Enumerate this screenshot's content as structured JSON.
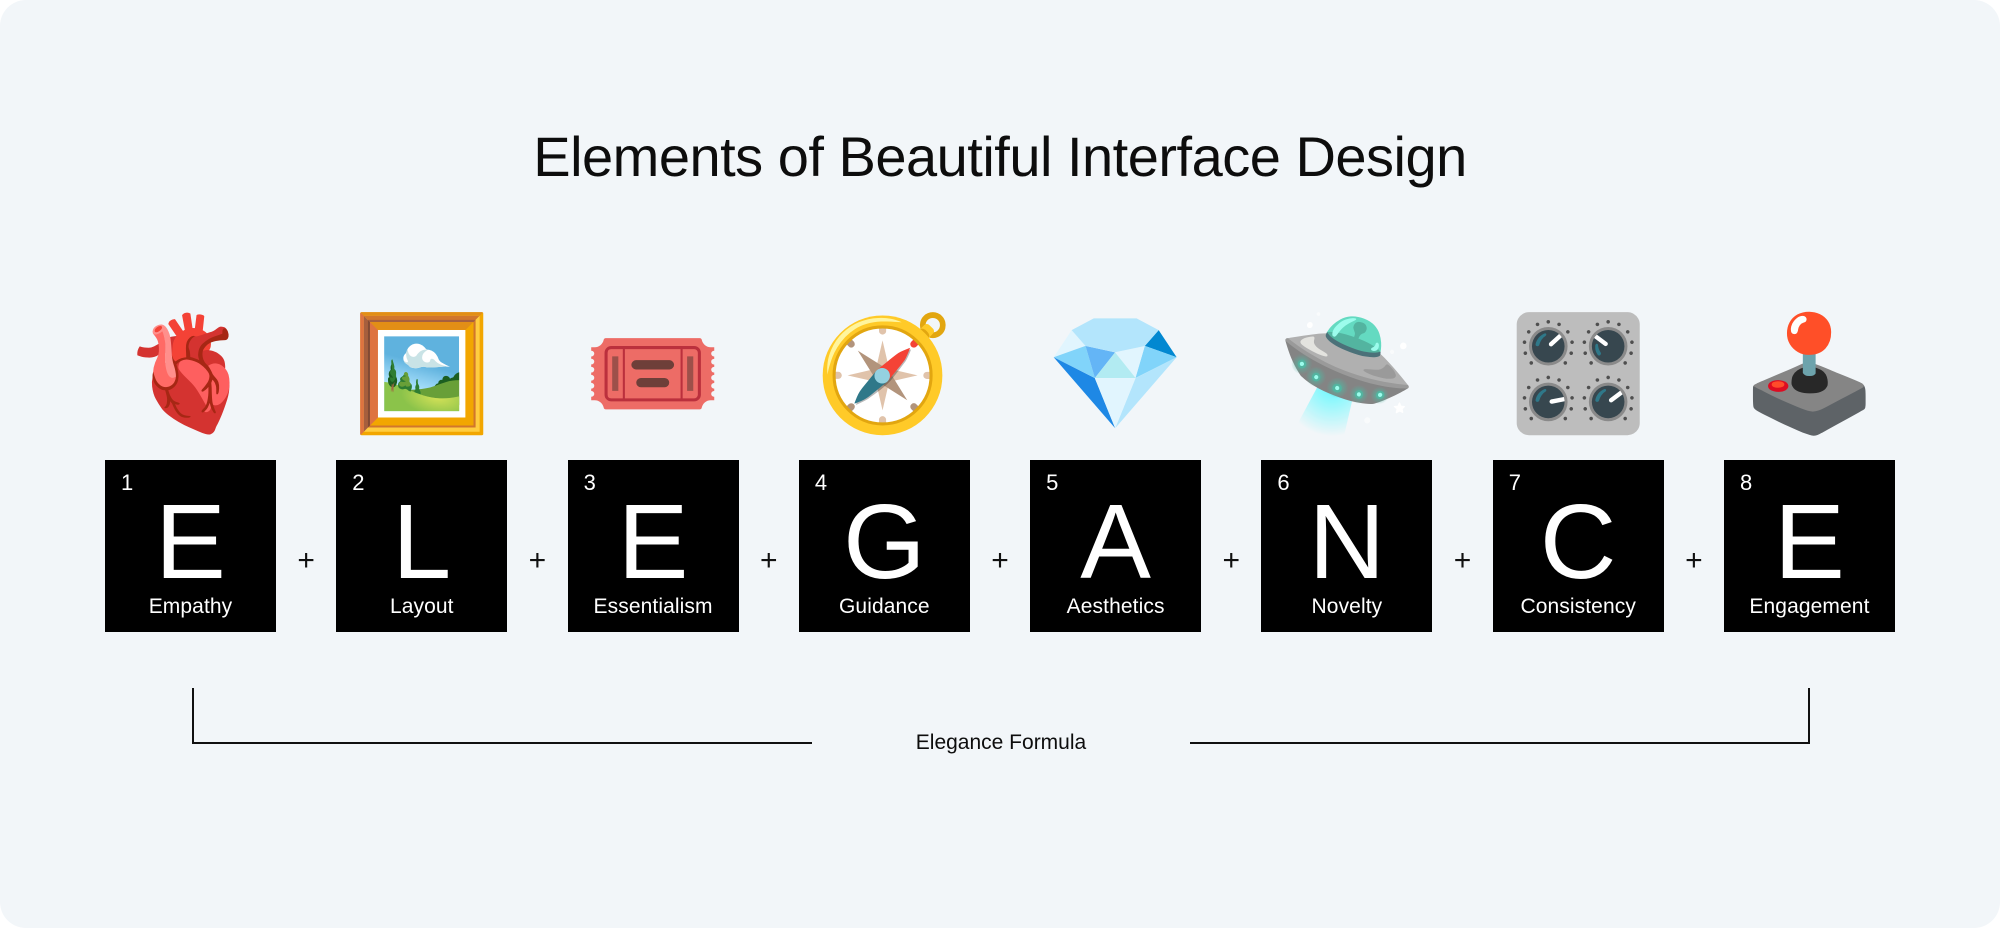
{
  "page": {
    "title": "Elements of Beautiful Interface Design",
    "background_color": "#f2f6f9",
    "card_color": "#000000",
    "card_text_color": "#ffffff",
    "text_color": "#0d0d0d",
    "separator_symbol": "+"
  },
  "elements": [
    {
      "index": "1",
      "letter": "E",
      "label": "Empathy",
      "emoji": "🫀",
      "emoji_name": "anatomical-heart-emoji"
    },
    {
      "index": "2",
      "letter": "L",
      "label": "Layout",
      "emoji": "🖼️",
      "emoji_name": "framed-picture-emoji"
    },
    {
      "index": "3",
      "letter": "E",
      "label": "Essentialism",
      "emoji": "🎟️",
      "emoji_name": "admission-ticket-emoji"
    },
    {
      "index": "4",
      "letter": "G",
      "label": "Guidance",
      "emoji": "🧭",
      "emoji_name": "compass-emoji"
    },
    {
      "index": "5",
      "letter": "A",
      "label": "Aesthetics",
      "emoji": "💎",
      "emoji_name": "gem-stone-emoji"
    },
    {
      "index": "6",
      "letter": "N",
      "label": "Novelty",
      "emoji": "🛸",
      "emoji_name": "flying-saucer-emoji"
    },
    {
      "index": "7",
      "letter": "C",
      "label": "Consistency",
      "emoji": "🎛️",
      "emoji_name": "control-knobs-emoji"
    },
    {
      "index": "8",
      "letter": "E",
      "label": "Engagement",
      "emoji": "🕹️",
      "emoji_name": "joystick-emoji"
    }
  ],
  "bracket": {
    "label": "Elegance Formula"
  },
  "separators": [
    "+",
    "+",
    "+",
    "+",
    "+",
    "+",
    "+"
  ]
}
